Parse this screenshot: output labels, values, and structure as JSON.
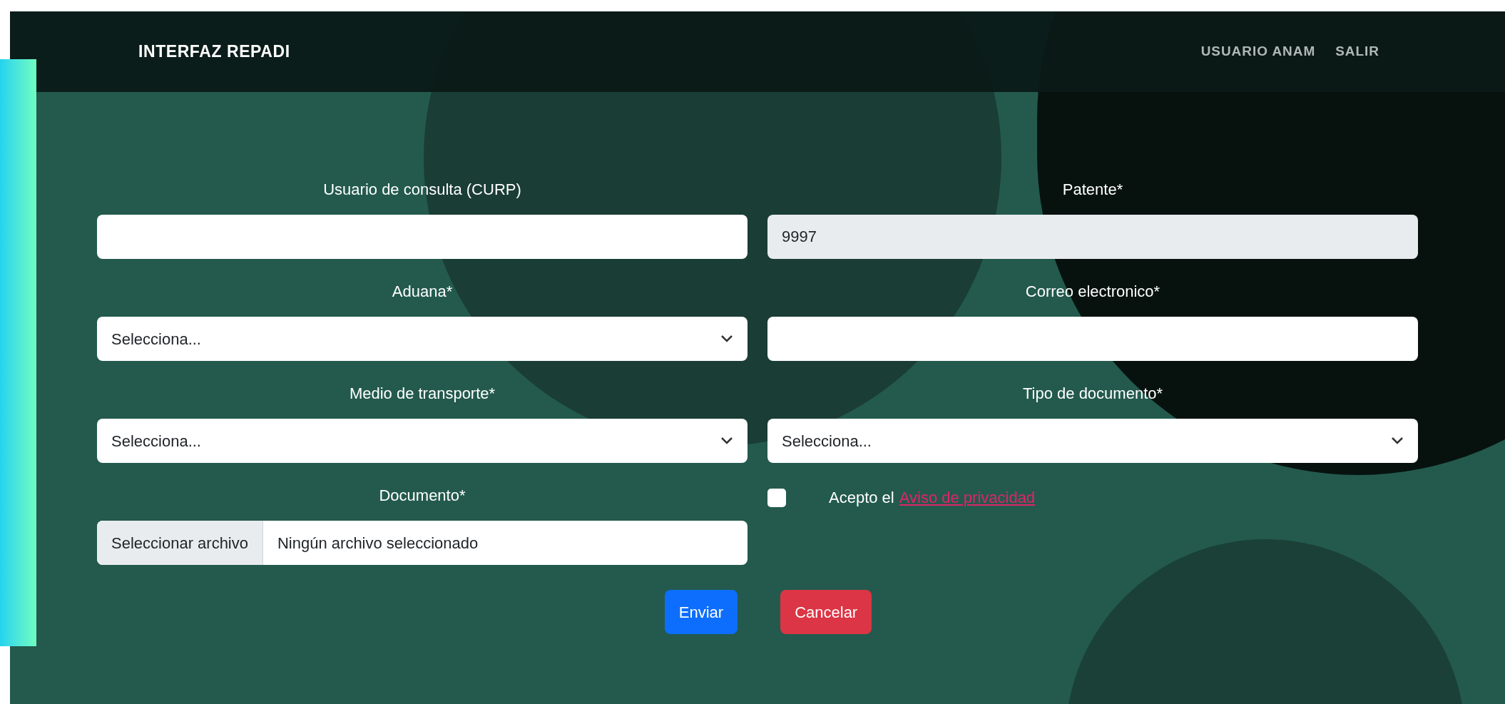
{
  "navbar": {
    "brand": "INTERFAZ REPADI",
    "links": [
      "USUARIO ANAM",
      "SALIR"
    ]
  },
  "fields": [
    {
      "kind": "text",
      "label": "Usuario de consulta (CURP)",
      "disabled": false
    },
    {
      "kind": "text",
      "label": "Patente*",
      "value": "9997",
      "disabled": true
    },
    {
      "kind": "select",
      "label": "Aduana*",
      "value": "Selecciona...",
      "disabled": false
    },
    {
      "kind": "text",
      "label": "Correo electronico*",
      "disabled": false
    },
    {
      "kind": "select",
      "label": "Medio de transporte*",
      "value": "Selecciona...",
      "disabled": false
    },
    {
      "kind": "select",
      "label": "Tipo de documento*",
      "value": "Selecciona...",
      "disabled": false
    },
    {
      "kind": "file",
      "label": "Documento*",
      "button": "Seleccionar archivo",
      "value": "Ningún archivo seleccionado",
      "disabled": false
    },
    {
      "kind": "checkbox",
      "text": "Acepto el",
      "link": "Aviso de privacidad",
      "checked": false
    }
  ],
  "buttons": [
    {
      "kind": "primary",
      "label": "Enviar"
    },
    {
      "kind": "danger",
      "label": "Cancelar"
    }
  ]
}
